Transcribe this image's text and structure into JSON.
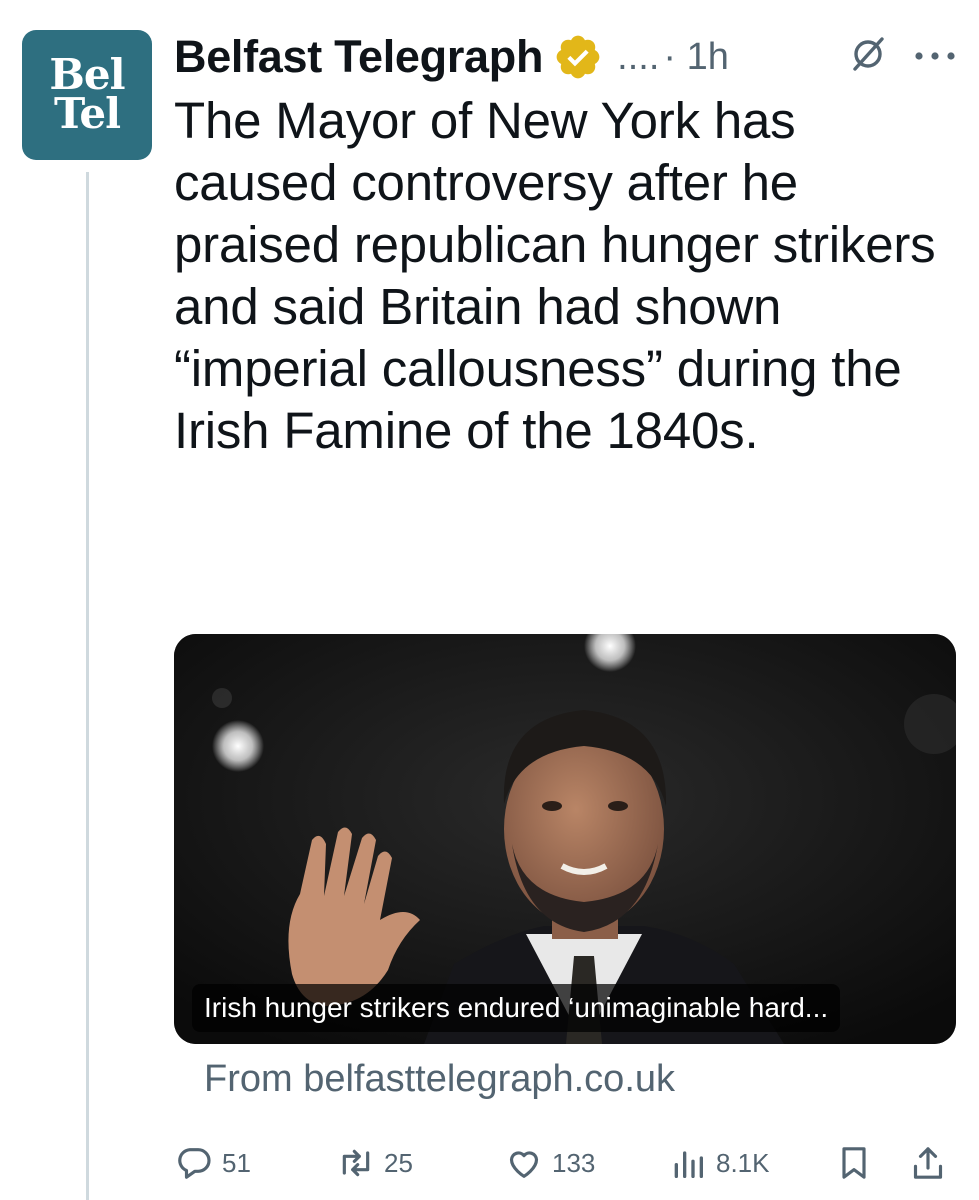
{
  "account": {
    "avatar_lines": [
      "Bel",
      "Tel"
    ],
    "name": "Belfast Telegraph",
    "handle": "....",
    "separator_time": "· 1h",
    "verified_color": "#e2b719"
  },
  "tweet": {
    "text": "The Mayor of New York has caused controversy after he praised republican hunger strikers and said Britain had shown “imperial callousness” during the Irish Famine of the 1840s."
  },
  "card": {
    "caption": "Irish hunger strikers endured ‘unimaginable hard...",
    "source": "From belfasttelegraph.co.uk"
  },
  "actions": {
    "replies": "51",
    "reposts": "25",
    "likes": "133",
    "views": "8.1K"
  },
  "colors": {
    "avatar_bg": "#2e6f80",
    "text_secondary": "#536471",
    "thread_line": "#cfd9de"
  },
  "icons": [
    "verified-badge-icon",
    "grok-icon",
    "more-icon",
    "reply-icon",
    "repost-icon",
    "like-icon",
    "views-icon",
    "bookmark-icon",
    "share-icon"
  ]
}
